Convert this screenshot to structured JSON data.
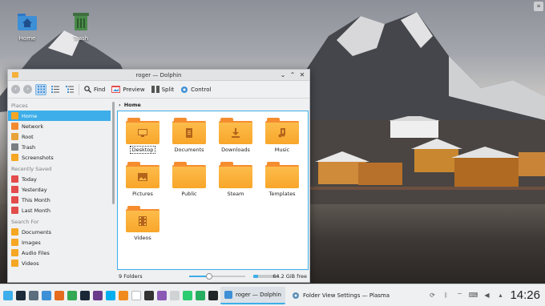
{
  "desktop": {
    "icons": [
      {
        "label": "Home",
        "icon": "home-folder-icon"
      },
      {
        "label": "Trash",
        "icon": "trash-icon"
      }
    ]
  },
  "window": {
    "title": "roger — Dolphin",
    "controls": {
      "minimize": "⌄",
      "maximize": "⌃",
      "close": "✕"
    },
    "toolbar": {
      "back": "‹",
      "forward": "›",
      "find_label": "Find",
      "preview_label": "Preview",
      "split_label": "Split",
      "control_label": "Control"
    },
    "sidebar": {
      "places_heading": "Places",
      "places": [
        {
          "label": "Home",
          "color": "#f5a623",
          "active": true
        },
        {
          "label": "Network",
          "color": "#f28b30"
        },
        {
          "label": "Root",
          "color": "#e8a33a"
        },
        {
          "label": "Trash",
          "color": "#7a7f84"
        },
        {
          "label": "Screenshots",
          "color": "#f5a623"
        }
      ],
      "recent_heading": "Recently Saved",
      "recent": [
        {
          "label": "Today",
          "color": "#e24c4b"
        },
        {
          "label": "Yesterday",
          "color": "#e24c4b"
        },
        {
          "label": "This Month",
          "color": "#e24c4b"
        },
        {
          "label": "Last Month",
          "color": "#e24c4b"
        }
      ],
      "search_heading": "Search For",
      "search": [
        {
          "label": "Documents",
          "color": "#f5a623"
        },
        {
          "label": "Images",
          "color": "#f5a623"
        },
        {
          "label": "Audio Files",
          "color": "#f5a623"
        },
        {
          "label": "Videos",
          "color": "#f5a623"
        }
      ]
    },
    "breadcrumb": {
      "arrow": "›",
      "current": "Home"
    },
    "folders": [
      {
        "label": "Desktop",
        "glyph": "desktop-icon"
      },
      {
        "label": "Documents",
        "glyph": "document-icon"
      },
      {
        "label": "Downloads",
        "glyph": "download-icon"
      },
      {
        "label": "Music",
        "glyph": "music-icon"
      },
      {
        "label": "Pictures",
        "glyph": "picture-icon"
      },
      {
        "label": "Public",
        "glyph": "none"
      },
      {
        "label": "Steam",
        "glyph": "none"
      },
      {
        "label": "Templates",
        "glyph": "none"
      },
      {
        "label": "Videos",
        "glyph": "video-icon"
      }
    ],
    "status": {
      "count": "9 Folders",
      "zoom_fraction": 0.35,
      "free_space": "64.2 GiB free",
      "used_fraction": 0.2
    }
  },
  "panel": {
    "launchers": [
      {
        "name": "app-launcher-icon",
        "color": "#3daee9"
      },
      {
        "name": "terminal-app-icon",
        "color": "#1d2b3a"
      },
      {
        "name": "system-settings-icon",
        "color": "#5a6e7e"
      },
      {
        "name": "file-manager-icon",
        "color": "#3d8fd6"
      },
      {
        "name": "firefox-icon",
        "color": "#e56b1f"
      },
      {
        "name": "chrome-icon",
        "color": "#34a853"
      },
      {
        "name": "steam-icon",
        "color": "#1b2838"
      },
      {
        "name": "ksysguard-icon",
        "color": "#6a3a8b"
      },
      {
        "name": "skype-icon",
        "color": "#00aff0"
      },
      {
        "name": "vlc-icon",
        "color": "#f08a1c"
      },
      {
        "name": "media-player-icon",
        "color": "#ffffff"
      },
      {
        "name": "inkscape-icon",
        "color": "#333333"
      },
      {
        "name": "document-viewer-icon",
        "color": "#8a5ab5"
      },
      {
        "name": "text-editor-icon",
        "color": "#cfd3d6"
      },
      {
        "name": "system-monitor-icon",
        "color": "#2ecc71"
      },
      {
        "name": "kleopatra-icon",
        "color": "#27ae60"
      },
      {
        "name": "konsole-icon",
        "color": "#232629"
      }
    ],
    "tasks": [
      {
        "label": "roger — Dolphin",
        "active": true
      },
      {
        "label": "Folder View Settings — Plasma",
        "active": false
      }
    ],
    "clock": "14:26"
  }
}
